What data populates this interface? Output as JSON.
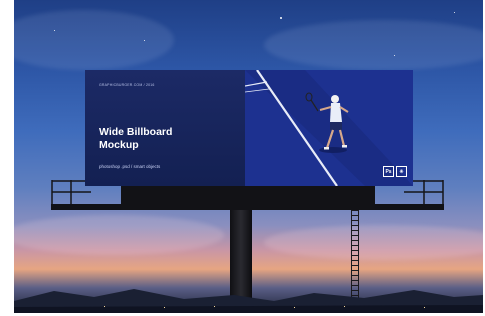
{
  "billboard": {
    "caption": "GRAPHICBURGER.COM / 2016",
    "headline_line1": "Wide Billboard",
    "headline_line2": "Mockup",
    "subline": "photoshop .psd / smart objects",
    "badge_ps": "Ps",
    "badge_star": "✳"
  },
  "colors": {
    "sky_top": "#1f3f86",
    "sky_horizon": "#e6a582",
    "board_left": "#132052",
    "board_right": "#1b2f8f"
  },
  "icons": [
    "photoshop-icon",
    "smart-object-icon"
  ]
}
